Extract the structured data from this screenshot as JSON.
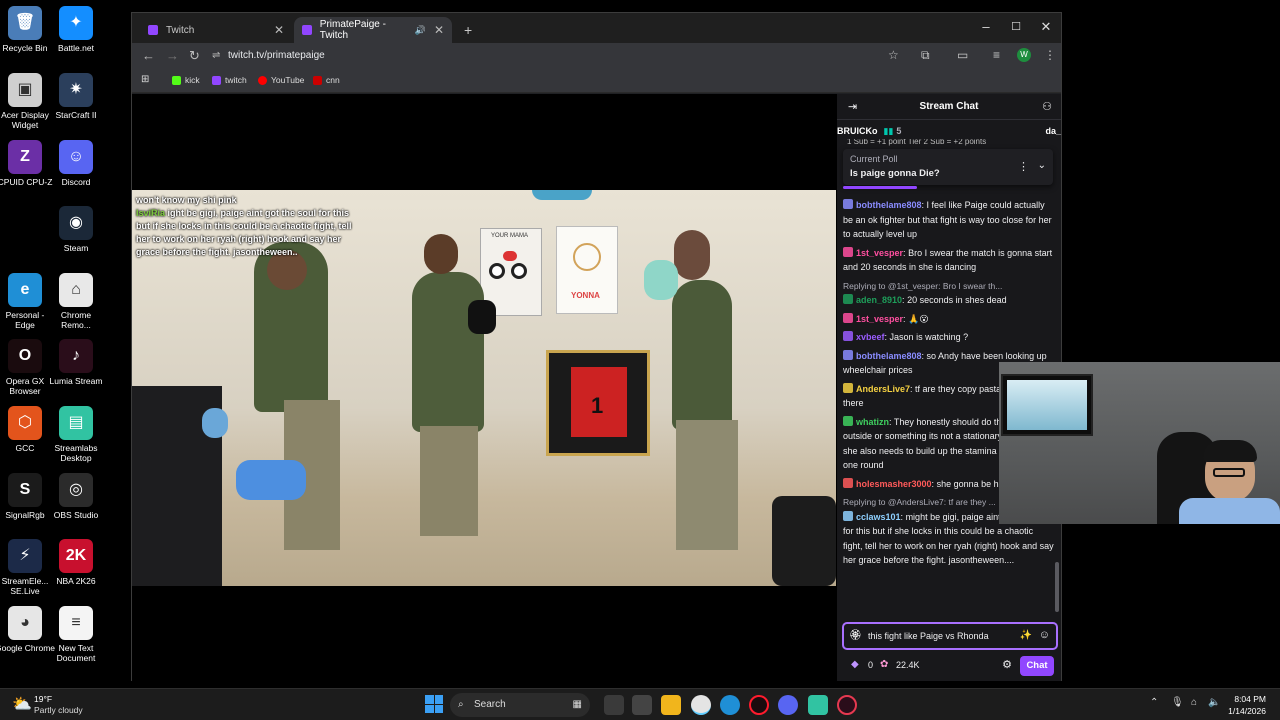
{
  "desktop": {
    "icons": [
      {
        "label": "Recycle Bin",
        "color": "#4a7db8",
        "glyph": "🗑"
      },
      {
        "label": "Battle.net",
        "color": "#148eff",
        "glyph": "✦"
      },
      {
        "label": "Acer Display Widget",
        "color": "#cfcfcf",
        "glyph": "▣"
      },
      {
        "label": "StarCraft II",
        "color": "#2b3f5c",
        "glyph": "✷"
      },
      {
        "label": "CPUID CPU-Z",
        "color": "#6b2fa6",
        "glyph": "Z"
      },
      {
        "label": "Discord",
        "color": "#5865f2",
        "glyph": "☺"
      },
      {
        "label": "Steam",
        "color": "#1b2838",
        "glyph": "◉"
      },
      {
        "label": "Personal - Edge",
        "color": "#1f8fd6",
        "glyph": "e"
      },
      {
        "label": "Chrome Remo...",
        "color": "#e8e8e8",
        "glyph": "⌂"
      },
      {
        "label": "Opera GX Browser",
        "color": "#1a0b0e",
        "glyph": "O"
      },
      {
        "label": "Lumia Stream",
        "color": "#2a0d1a",
        "glyph": "♪"
      },
      {
        "label": "GCC",
        "color": "#e3541c",
        "glyph": "⬡"
      },
      {
        "label": "Streamlabs Desktop",
        "color": "#31c3a2",
        "glyph": "▤"
      },
      {
        "label": "SignalRgb",
        "color": "#1b1b1b",
        "glyph": "S"
      },
      {
        "label": "OBS Studio",
        "color": "#2b2b2b",
        "glyph": "◎"
      },
      {
        "label": "StreamEle... SE.Live",
        "color": "#1c2a48",
        "glyph": "⚡"
      },
      {
        "label": "NBA 2K26",
        "color": "#c8102e",
        "glyph": "2K"
      },
      {
        "label": "Google Chrome",
        "color": "#e6e6e6",
        "glyph": "◕"
      },
      {
        "label": "New Text Document",
        "color": "#f4f4f4",
        "glyph": "≡"
      }
    ]
  },
  "browser": {
    "tabs": [
      {
        "title": "Twitch",
        "active": false
      },
      {
        "title": "PrimatePaige - Twitch",
        "active": true
      }
    ],
    "new_tab": "+",
    "window_controls": {
      "minimize": "–",
      "maximize": "☐",
      "close": "✕"
    },
    "url": "twitch.tv/primatepaige",
    "profile_initial": "W",
    "bookmarks": [
      {
        "label": "kick",
        "color": "#53fc18"
      },
      {
        "label": "twitch",
        "color": "#9146ff"
      },
      {
        "label": "YouTube",
        "color": "#ff0000"
      },
      {
        "label": "cnn",
        "color": "#cc0000"
      }
    ]
  },
  "stream": {
    "overlay_lines": [
      {
        "user": "",
        "text": "won't know my shi pink"
      },
      {
        "user": "lsviRia",
        "text": "ight be gigi, paige aint got the soul for this but if she locks in this could be a chaotic fight, tell her to work on her ryah (right) hook and say her grace before the fight. jasontheween.."
      }
    ],
    "wall_sign": "YOUR MAMA",
    "kid_sign": "YONNA"
  },
  "chat": {
    "title": "Stream Chat",
    "gift_left": "BRUICKo",
    "gift_count": "5",
    "gift_right": "da_",
    "ticker": "1 Sub = +1 point   Tier 2 Sub = +2 points",
    "poll": {
      "label": "Current Poll",
      "question": "Is paige gonna Die?"
    },
    "messages": [
      {
        "user": "bobthelame808",
        "color": "#8a8cff",
        "text": "I feel like Paige could actually be an ok fighter but that fight is way too close for her to actually level up",
        "reply": ""
      },
      {
        "user": "1st_vesper",
        "color": "#ff4fa0",
        "text": "Bro I swear the match is gonna start and 20 seconds in she is dancing",
        "reply": ""
      },
      {
        "user": "aden_8910",
        "color": "#1e9e5a",
        "text": "20 seconds in shes dead",
        "reply": "Replying to @1st_vesper: Bro I swear th..."
      },
      {
        "user": "1st_vesper",
        "color": "#ff4fa0",
        "text": "🙏😮",
        "reply": ""
      },
      {
        "user": "xvbeef",
        "color": "#9a5cff",
        "text": "Jason is watching ?",
        "reply": ""
      },
      {
        "user": "bobthelame808",
        "color": "#8a8cff",
        "text": "so Andy have been looking up wheelchair prices",
        "reply": ""
      },
      {
        "user": "AndersLive7",
        "color": "#f5d142",
        "text": "tf are they copy pastaing over there",
        "reply": ""
      },
      {
        "user": "whatizn",
        "color": "#3fcf5f",
        "text": "They honestly should do this like outside or something its not a stationary sport and she also needs to build up the stamina for at least one round",
        "reply": ""
      },
      {
        "user": "holesmasher3000",
        "color": "#ff5a5a",
        "text": "she gonna be hitting this",
        "reply": ""
      },
      {
        "user": "cclaws101",
        "color": "#8fd0ff",
        "text": "might be gigi, paige aint got the soul for this but if she locks in this could be a chaotic fight, tell her to work on her ryah (right) hook and say her grace before the fight. jasontheween....",
        "reply": "Replying to @AndersLive7: tf are they ..."
      }
    ],
    "input_value": "this fight like Paige vs Rhonda",
    "bits": "0",
    "points": "22.4K",
    "chat_button": "Chat"
  },
  "taskbar": {
    "weather_temp": "19°F",
    "weather_desc": "Partly cloudy",
    "search_label": "Search",
    "time": "8:04 PM",
    "date": "1/14/2026"
  }
}
